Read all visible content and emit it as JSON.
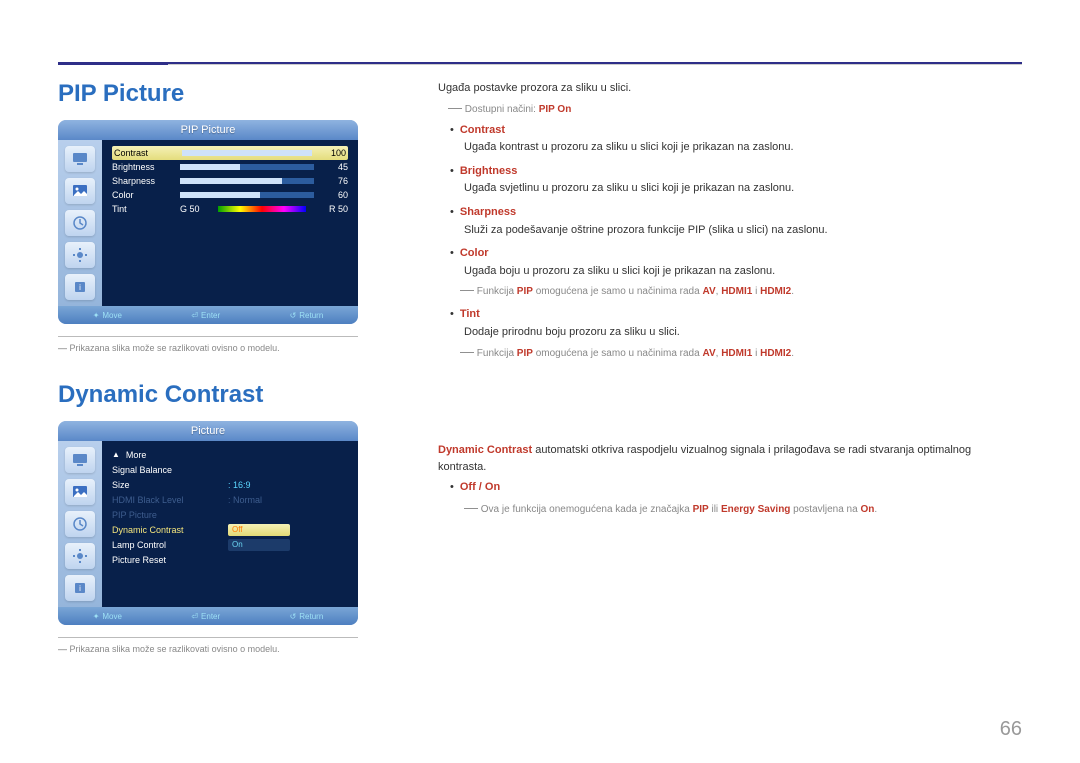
{
  "colors": {
    "brand": "#2a6ebf",
    "accent": "#c0392b"
  },
  "page_number": "66",
  "pip": {
    "heading": "PIP Picture",
    "osd_title": "PIP Picture",
    "rows": {
      "contrast": {
        "label": "Contrast",
        "value": "100",
        "fill_pct": 100
      },
      "brightness": {
        "label": "Brightness",
        "value": "45",
        "fill_pct": 45
      },
      "sharpness": {
        "label": "Sharpness",
        "value": "76",
        "fill_pct": 76
      },
      "color": {
        "label": "Color",
        "value": "60",
        "fill_pct": 60
      },
      "tint": {
        "label": "Tint",
        "left": "G  50",
        "right": "R  50"
      }
    },
    "footer": {
      "move": "Move",
      "enter": "Enter",
      "return": "Return"
    },
    "footnote": "Prikazana slika može se razlikovati ovisno o modelu.",
    "intro": "Ugađa postavke prozora za sliku u slici.",
    "avail_modes_prefix": "Dostupni načini: ",
    "avail_modes_value": "PIP On",
    "items": {
      "contrast": {
        "title": "Contrast",
        "body": "Ugađa kontrast u prozoru za sliku u slici koji je prikazan na zaslonu."
      },
      "brightness": {
        "title": "Brightness",
        "body": "Ugađa svjetlinu u prozoru za sliku u slici koji je prikazan na zaslonu."
      },
      "sharpness": {
        "title": "Sharpness",
        "body": "Služi za podešavanje oštrine prozora funkcije PIP (slika u slici) na zaslonu."
      },
      "color": {
        "title": "Color",
        "body": "Ugađa boju u prozoru za sliku u slici koji je prikazan na zaslonu."
      },
      "tint": {
        "title": "Tint",
        "body": "Dodaje prirodnu boju prozoru za sliku u slici."
      }
    },
    "note_prefix": "Funkcija ",
    "note_pip": "PIP",
    "note_mid": " omogućena je samo u načinima rada ",
    "note_av": "AV",
    "note_sep": ", ",
    "note_hdmi1": "HDMI1",
    "note_and": " i ",
    "note_hdmi2": "HDMI2",
    "note_end": "."
  },
  "dc": {
    "heading": "Dynamic Contrast",
    "osd_title": "Picture",
    "rows": {
      "more": "More",
      "signal_balance": "Signal Balance",
      "size": {
        "label": "Size",
        "value": "16:9"
      },
      "hdmi_black": {
        "label": "HDMI Black Level",
        "value": "Normal"
      },
      "pip_picture": "PIP Picture",
      "dynamic_contrast": {
        "label": "Dynamic Contrast",
        "options": {
          "off": "Off",
          "on": "On"
        }
      },
      "lamp_control": "Lamp Control",
      "picture_reset": "Picture Reset"
    },
    "footer": {
      "move": "Move",
      "enter": "Enter",
      "return": "Return"
    },
    "footnote": "Prikazana slika može se razlikovati ovisno o modelu.",
    "desc_prefix_strong": "Dynamic Contrast",
    "desc_body": " automatski otkriva raspodjelu vizualnog signala i prilagođava se radi stvaranja optimalnog kontrasta.",
    "off_on": "Off / On",
    "note_prefix": "Ova je funkcija onemogućena kada je značajka ",
    "note_pip": "PIP",
    "note_or": " ili ",
    "note_es": "Energy Saving",
    "note_mid": " postavljena na ",
    "note_on": "On",
    "note_end": "."
  }
}
